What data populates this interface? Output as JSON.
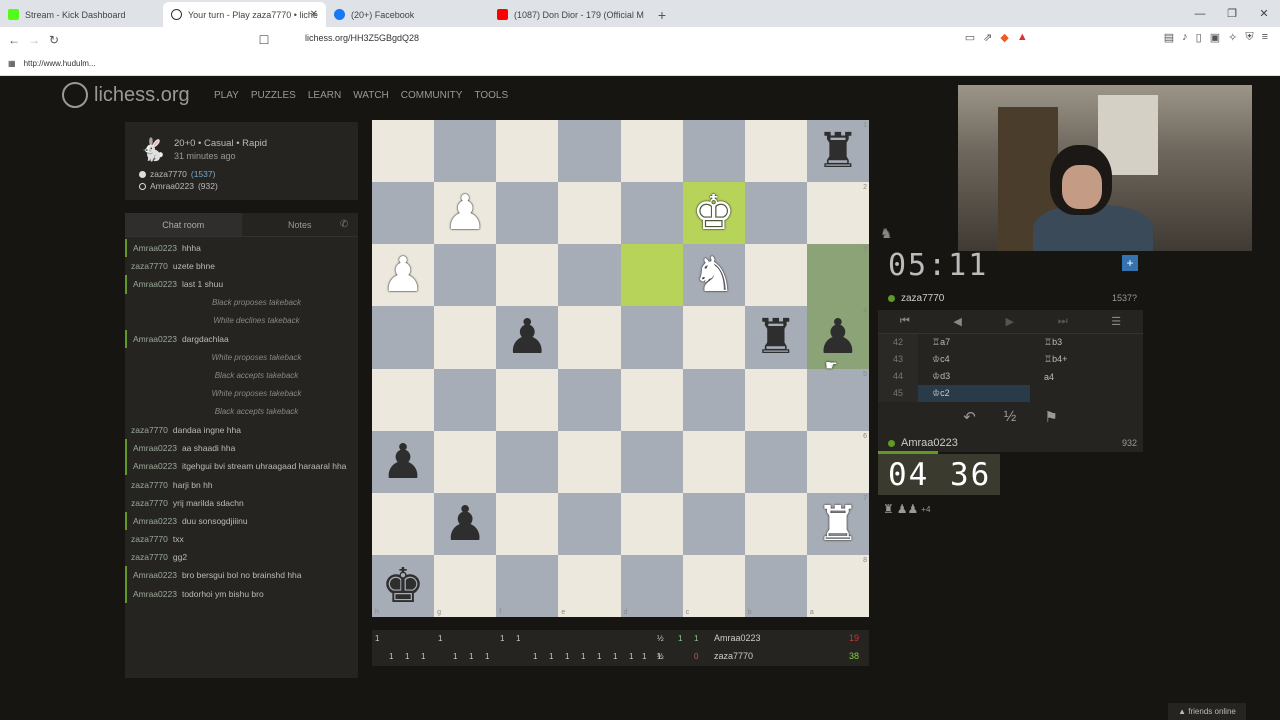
{
  "browser": {
    "tabs": [
      {
        "label": "Stream - Kick Dashboard",
        "fav": "#53fc18"
      },
      {
        "label": "Your turn - Play zaza7770 • liche",
        "fav": "#333"
      },
      {
        "label": "(20+) Facebook",
        "fav": "#1877f2"
      },
      {
        "label": "(1087) Don Dior - 179 (Official M",
        "fav": "#ff0000"
      }
    ],
    "url": "lichess.org/HH3Z5GBgdQ28",
    "bookmark": "http://www.hudulm..."
  },
  "site": {
    "logo": "lichess.org",
    "nav": [
      "PLAY",
      "PUZZLES",
      "LEARN",
      "WATCH",
      "COMMUNITY",
      "TOOLS"
    ]
  },
  "game": {
    "type": "20+0 • Casual • Rapid",
    "ago": "31 minutes ago",
    "white": "zaza7770",
    "white_rating": "(1537)",
    "black": "Amraa0223",
    "black_rating": "(932)"
  },
  "chat": {
    "tab_chat": "Chat room",
    "tab_notes": "Notes",
    "messages": [
      {
        "user": "Amraa0223",
        "text": "hhha",
        "kind": "green"
      },
      {
        "user": "zaza7770",
        "text": "uzete bhne",
        "kind": "plain"
      },
      {
        "user": "Amraa0223",
        "text": "last 1 shuu",
        "kind": "green"
      },
      {
        "user": "",
        "text": "Black proposes takeback",
        "kind": "sys"
      },
      {
        "user": "",
        "text": "White declines takeback",
        "kind": "sys"
      },
      {
        "user": "Amraa0223",
        "text": "dargdachlaa",
        "kind": "green"
      },
      {
        "user": "",
        "text": "White proposes takeback",
        "kind": "sys"
      },
      {
        "user": "",
        "text": "Black accepts takeback",
        "kind": "sys"
      },
      {
        "user": "",
        "text": "White proposes takeback",
        "kind": "sys"
      },
      {
        "user": "",
        "text": "Black accepts takeback",
        "kind": "sys"
      },
      {
        "user": "zaza7770",
        "text": "dandaa ingne hha",
        "kind": "plain"
      },
      {
        "user": "Amraa0223",
        "text": "aa shaadi hha",
        "kind": "green"
      },
      {
        "user": "Amraa0223",
        "text": "itgehgui bvi stream uhraagaad haraaral hha",
        "kind": "green"
      },
      {
        "user": "zaza7770",
        "text": "harji bn hh",
        "kind": "plain"
      },
      {
        "user": "zaza7770",
        "text": "yrij marilda sdachn",
        "kind": "plain"
      },
      {
        "user": "Amraa0223",
        "text": "duu sonsogdjiiinu",
        "kind": "green"
      },
      {
        "user": "zaza7770",
        "text": "txx",
        "kind": "plain"
      },
      {
        "user": "zaza7770",
        "text": "gg2",
        "kind": "plain"
      },
      {
        "user": "Amraa0223",
        "text": "bro bersgui bol no brainshd hha",
        "kind": "green"
      },
      {
        "user": "Amraa0223",
        "text": "todorhoi ym bishu bro",
        "kind": "green"
      }
    ]
  },
  "board": {
    "ranks": [
      "1",
      "2",
      "3",
      "4",
      "5",
      "6",
      "7",
      "8"
    ],
    "files": [
      "h",
      "g",
      "f",
      "e",
      "d",
      "c",
      "b",
      "a"
    ],
    "pieces": [
      {
        "sq": "a1",
        "glyph": "♜",
        "color": "b"
      },
      {
        "sq": "g2",
        "glyph": "♟",
        "color": "w"
      },
      {
        "sq": "c2",
        "glyph": "♚",
        "color": "w"
      },
      {
        "sq": "h3",
        "glyph": "♟",
        "color": "w"
      },
      {
        "sq": "c3",
        "glyph": "♞",
        "color": "w"
      },
      {
        "sq": "f4",
        "glyph": "♟",
        "color": "b"
      },
      {
        "sq": "b4",
        "glyph": "♜",
        "color": "b"
      },
      {
        "sq": "a4",
        "glyph": "♟",
        "color": "b"
      },
      {
        "sq": "h6",
        "glyph": "♟",
        "color": "b"
      },
      {
        "sq": "g7",
        "glyph": "♟",
        "color": "b"
      },
      {
        "sq": "a7",
        "glyph": "♜",
        "color": "w"
      },
      {
        "sq": "h8",
        "glyph": "♚",
        "color": "b"
      }
    ],
    "highlights": [
      {
        "sq": "c2",
        "kind": "hl"
      },
      {
        "sq": "d3",
        "kind": "hl"
      },
      {
        "sq": "a3",
        "kind": "hlg"
      },
      {
        "sq": "a4",
        "kind": "hlg"
      }
    ]
  },
  "crosstable": {
    "top_scores": [
      "1",
      "1",
      "1",
      "1"
    ],
    "top_half": "½",
    "bottom_scores": [
      "1",
      "1",
      "1",
      "1",
      "1",
      "1",
      "1",
      "1",
      "1",
      "1",
      "1",
      "1",
      "1",
      "1",
      "1"
    ],
    "bottom_half": "½",
    "p1_name": "Amraa0223",
    "p1_pts": "19",
    "p1_w": "1",
    "p2_name": "zaza7770",
    "p2_pts": "38",
    "p2_w": "0",
    "p1_ind": "1"
  },
  "right": {
    "clock_top": "05:11",
    "top_player": "zaza7770",
    "top_rating": "1537?",
    "moves": [
      {
        "n": "42",
        "w": "♖a7",
        "b": "♖b3"
      },
      {
        "n": "43",
        "w": "♔c4",
        "b": "♖b4+"
      },
      {
        "n": "44",
        "w": "♔d3",
        "b": "a4"
      },
      {
        "n": "45",
        "w": "♔c2",
        "b": ""
      }
    ],
    "bottom_player": "Amraa0223",
    "bottom_rating": "932",
    "clock_bottom": "04 36",
    "material_plus": "+4",
    "friends": "friends online"
  },
  "colors": {
    "accent": "#629924",
    "bg": "#161512",
    "panel": "#262421"
  }
}
